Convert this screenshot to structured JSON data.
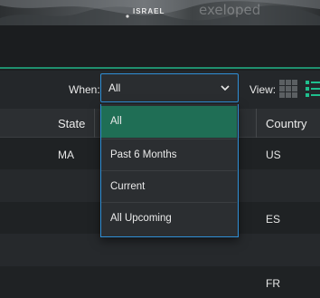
{
  "map_banner": {
    "region_label": "ISRAEL",
    "watermark": "exeloped"
  },
  "toolbar": {
    "when_label": "When:",
    "when_value": "All",
    "view_label": "View:"
  },
  "table": {
    "columns": [
      "State",
      "Country"
    ],
    "rows": [
      {
        "state": "MA",
        "country": "US"
      },
      {
        "state": "",
        "country": ""
      },
      {
        "state": "",
        "country": "ES"
      },
      {
        "state": "",
        "country": ""
      },
      {
        "state": "",
        "country": "FR"
      }
    ]
  },
  "dropdown": {
    "options": [
      "All",
      "Past 6 Months",
      "Current",
      "All Upcoming"
    ],
    "selected": "All"
  },
  "colors": {
    "accent_green": "#1f8f6e",
    "selected_option": "#1f6e55",
    "focus_border": "#2f8fd6"
  },
  "icons": [
    "chevron-down-icon",
    "grid-view-icon",
    "list-view-icon"
  ]
}
